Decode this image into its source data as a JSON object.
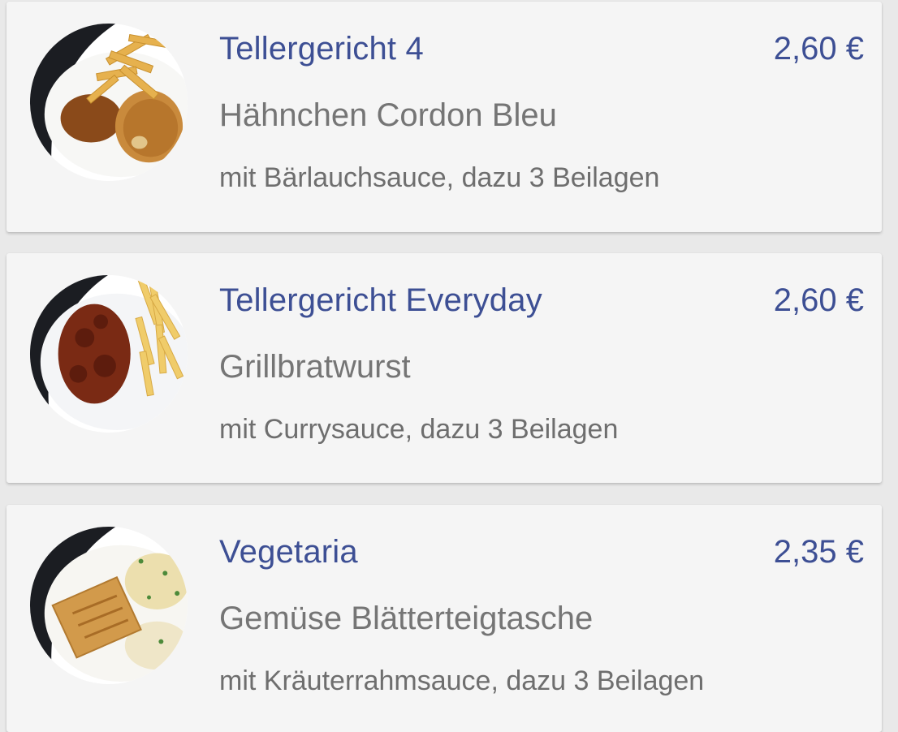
{
  "menu": {
    "items": [
      {
        "title": "Tellergericht 4",
        "price": "2,60 €",
        "dish": "Hähnchen Cordon Bleu",
        "description": "mit Bärlauchsauce, dazu 3 Beilagen",
        "image_icon": "cordon-bleu-plate-photo"
      },
      {
        "title": "Tellergericht Everyday",
        "price": "2,60 €",
        "dish": "Grillbratwurst",
        "description": "mit Currysauce, dazu 3 Beilagen",
        "image_icon": "currywurst-plate-photo"
      },
      {
        "title": "Vegetaria",
        "price": "2,35 €",
        "dish": "Gemüse Blätterteigtasche",
        "description": "mit Kräuterrahmsauce, dazu 3 Beilagen",
        "image_icon": "pastry-plate-photo"
      }
    ]
  },
  "colors": {
    "title": "#3d4f94",
    "price": "#3d4f94",
    "dish": "#757575",
    "card_bg": "#f5f5f5"
  }
}
